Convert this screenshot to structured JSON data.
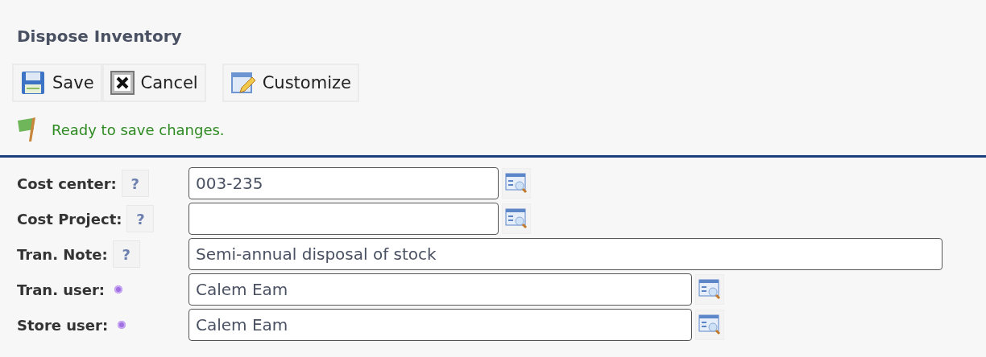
{
  "title": "Dispose Inventory",
  "toolbar": [
    {
      "kind": "save",
      "label": "Save"
    },
    {
      "kind": "cancel",
      "label": "Cancel"
    },
    {
      "kind": "customize",
      "label": "Customize"
    }
  ],
  "status_message": "Ready to save changes.",
  "fields": [
    {
      "label": "Cost center:",
      "kind": "help",
      "help": "?",
      "value": "003-235",
      "lookup": true
    },
    {
      "label": "Cost Project:",
      "kind": "help",
      "help": "?",
      "lookup": true
    },
    {
      "label": "Tran. Note:",
      "kind": "help",
      "help": "?",
      "value": "Semi-annual disposal of stock",
      "lookup": false
    },
    {
      "label": "Tran. user:",
      "kind": "required",
      "value": "Calem Eam",
      "lookup": true
    },
    {
      "label": "Store user:",
      "kind": "required",
      "value": "Calem Eam",
      "lookup": true
    }
  ]
}
